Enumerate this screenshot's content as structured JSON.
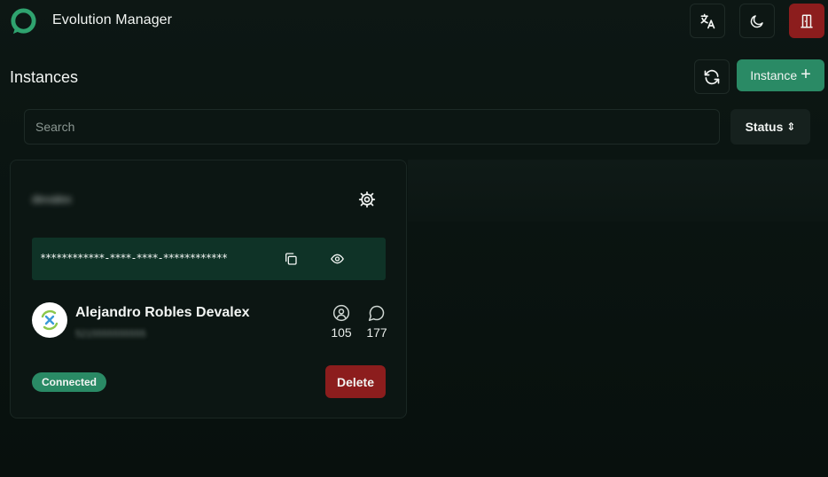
{
  "app": {
    "title": "Evolution Manager",
    "icons": {
      "logo": "chat-bubble-logo",
      "language": "translate-icon",
      "theme": "moon-icon",
      "logout": "door-icon"
    }
  },
  "instances": {
    "title": "Instances",
    "refresh_icon": "refresh-icon",
    "new_instance_label": "Instance",
    "new_instance_icon": "+",
    "search": {
      "placeholder": "Search",
      "value": ""
    },
    "status_filter": {
      "label": "Status",
      "icon": "⇕"
    },
    "cards": [
      {
        "name": "devalex",
        "token_masked": "************-****-****-************",
        "profile_name": "Alejandro Robles Devalex",
        "profile_number": "5215555555555",
        "contacts": "105",
        "chats": "177",
        "status": "Connected",
        "delete_label": "Delete"
      }
    ]
  },
  "colors": {
    "accent": "#2a8a65",
    "danger": "#8c1d1d",
    "background": "#0a1210",
    "token_bg": "#0f3327"
  }
}
